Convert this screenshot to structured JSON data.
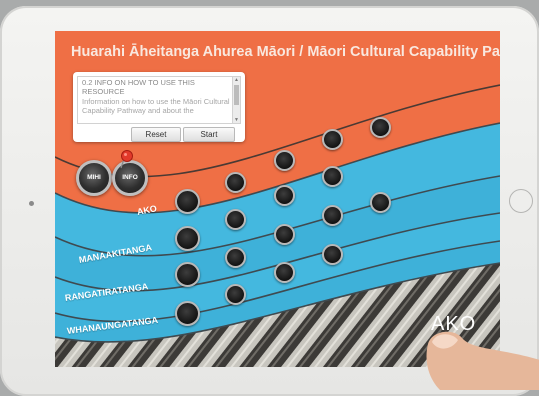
{
  "header": {
    "title": "Huarahi Āheitanga Ahurea Māori / Māori Cultural Capability Pathway"
  },
  "info_panel": {
    "heading": "0.2 INFO ON HOW TO USE THIS RESOURCE",
    "body": "Information on how to use the Māori Cultural Capability Pathway and about the",
    "reset_label": "Reset",
    "start_label": "Start"
  },
  "nav": {
    "mihi_label": "MIHI",
    "info_label": "INFO"
  },
  "bands": [
    {
      "label": "AKO"
    },
    {
      "label": "MANAAKITANGA"
    },
    {
      "label": "RANGATIRATANGA"
    },
    {
      "label": "WHANAUNGATANGA"
    }
  ],
  "logo": {
    "text": "AKO"
  },
  "colors": {
    "background": "#ef6f45",
    "band": "#44b8df",
    "node": "#1b1b1b",
    "title": "#f9e8df"
  },
  "icons": {
    "pin": "pushpin-icon",
    "logo_mark": "ako-logo"
  }
}
